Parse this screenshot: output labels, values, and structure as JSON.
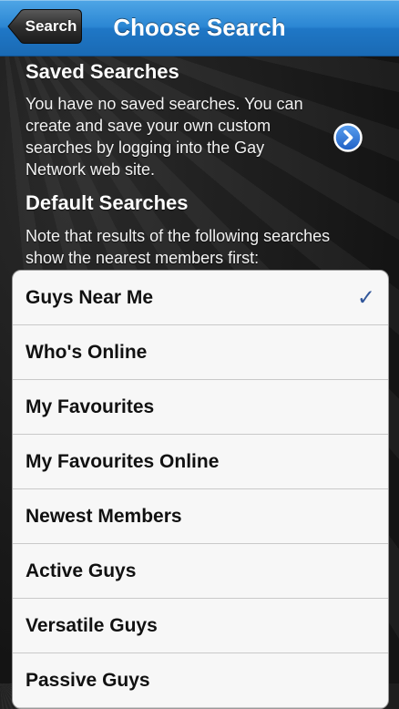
{
  "nav": {
    "back_label": "Search",
    "title": "Choose Search"
  },
  "saved": {
    "title": "Saved Searches",
    "text": "You have no saved searches. You can create and save your own custom searches by logging into the Gay Network web site."
  },
  "defaults": {
    "title": "Default Searches",
    "text": "Note that results of the following searches show the nearest members first:"
  },
  "rows": [
    {
      "label": "Guys Near Me",
      "checked": true
    },
    {
      "label": "Who's Online",
      "checked": false
    },
    {
      "label": "My Favourites",
      "checked": false
    },
    {
      "label": "My Favourites Online",
      "checked": false
    },
    {
      "label": "Newest Members",
      "checked": false
    },
    {
      "label": "Active Guys",
      "checked": false
    },
    {
      "label": "Versatile Guys",
      "checked": false
    },
    {
      "label": "Passive Guys",
      "checked": false
    }
  ],
  "checkmark": "✓",
  "colors": {
    "nav_blue": "#2b86d3",
    "check_blue": "#33589b",
    "table_bg": "#f7f7f7"
  }
}
